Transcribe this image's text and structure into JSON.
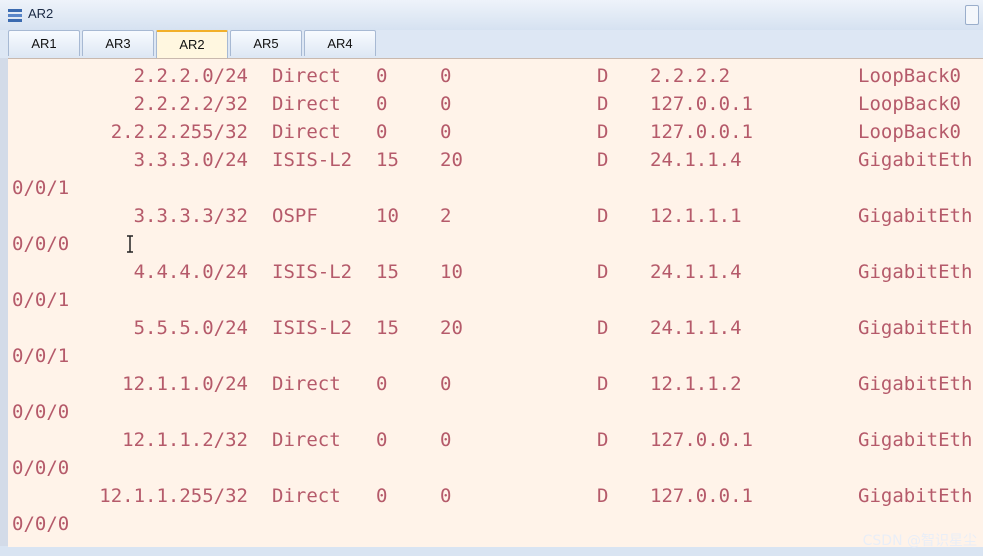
{
  "window": {
    "title": "AR2"
  },
  "tabs": [
    {
      "label": "AR1"
    },
    {
      "label": "AR3"
    },
    {
      "label": "AR2",
      "active": true
    },
    {
      "label": "AR5"
    },
    {
      "label": "AR4"
    }
  ],
  "routes": [
    {
      "dest": "2.2.2.0/24",
      "proto": "Direct",
      "pre": "0",
      "cost": "0",
      "flags": "D",
      "nexthop": "2.2.2.2",
      "iface": "LoopBack0",
      "cont": ""
    },
    {
      "dest": "2.2.2.2/32",
      "proto": "Direct",
      "pre": "0",
      "cost": "0",
      "flags": "D",
      "nexthop": "127.0.0.1",
      "iface": "LoopBack0",
      "cont": ""
    },
    {
      "dest": "2.2.2.255/32",
      "proto": "Direct",
      "pre": "0",
      "cost": "0",
      "flags": "D",
      "nexthop": "127.0.0.1",
      "iface": "LoopBack0",
      "cont": ""
    },
    {
      "dest": "3.3.3.0/24",
      "proto": "ISIS-L2",
      "pre": "15",
      "cost": "20",
      "flags": "D",
      "nexthop": "24.1.1.4",
      "iface": "GigabitEth",
      "cont": "0/0/1"
    },
    {
      "dest": "3.3.3.3/32",
      "proto": "OSPF",
      "pre": "10",
      "cost": "2",
      "flags": "D",
      "nexthop": "12.1.1.1",
      "iface": "GigabitEth",
      "cont": "0/0/0"
    },
    {
      "dest": "4.4.4.0/24",
      "proto": "ISIS-L2",
      "pre": "15",
      "cost": "10",
      "flags": "D",
      "nexthop": "24.1.1.4",
      "iface": "GigabitEth",
      "cont": "0/0/1"
    },
    {
      "dest": "5.5.5.0/24",
      "proto": "ISIS-L2",
      "pre": "15",
      "cost": "20",
      "flags": "D",
      "nexthop": "24.1.1.4",
      "iface": "GigabitEth",
      "cont": "0/0/1"
    },
    {
      "dest": "12.1.1.0/24",
      "proto": "Direct",
      "pre": "0",
      "cost": "0",
      "flags": "D",
      "nexthop": "12.1.1.2",
      "iface": "GigabitEth",
      "cont": "0/0/0"
    },
    {
      "dest": "12.1.1.2/32",
      "proto": "Direct",
      "pre": "0",
      "cost": "0",
      "flags": "D",
      "nexthop": "127.0.0.1",
      "iface": "GigabitEth",
      "cont": "0/0/0"
    },
    {
      "dest": "12.1.1.255/32",
      "proto": "Direct",
      "pre": "0",
      "cost": "0",
      "flags": "D",
      "nexthop": "127.0.0.1",
      "iface": "GigabitEth",
      "cont": "0/0/0"
    }
  ],
  "watermark": "CSDN @智识星尘",
  "colors": {
    "console_bg": "#fff3e9",
    "console_text": "#b55a6a",
    "active_tab": "#f2b02a"
  }
}
